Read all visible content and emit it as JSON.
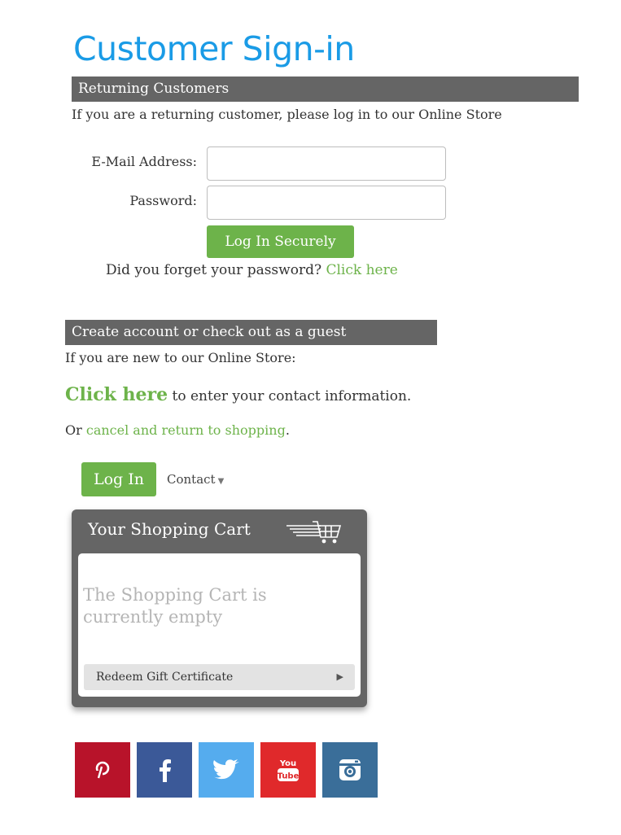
{
  "page": {
    "title": "Customer Sign-in"
  },
  "returning": {
    "header": "Returning Customers",
    "intro": "If you are a returning customer, please log in to our Online Store",
    "email_label": "E-Mail Address:",
    "email_value": "",
    "password_label": "Password:",
    "password_value": "",
    "login_button": "Log In Securely",
    "forgot_text": "Did you forget your password?",
    "forgot_link": "Click here"
  },
  "create": {
    "header": "Create account or check out as a guest",
    "intro": "If you are new to our Online Store:",
    "click_here": "Click here",
    "click_here_suffix": "to enter your contact information.",
    "or_text": "Or",
    "cancel_link": "cancel and return to shopping",
    "cancel_suffix": "."
  },
  "nav": {
    "login_button": "Log In",
    "contact_label": "Contact"
  },
  "cart": {
    "title": "Your Shopping Cart",
    "empty_message": "The Shopping Cart is currently empty",
    "redeem_label": "Redeem Gift Certificate"
  },
  "social": [
    {
      "name": "pinterest-icon",
      "color": "#b8132a"
    },
    {
      "name": "facebook-icon",
      "color": "#3b5998"
    },
    {
      "name": "twitter-icon",
      "color": "#55acee"
    },
    {
      "name": "youtube-icon",
      "color": "#e0292b",
      "text_top": "You",
      "text_bottom": "Tube"
    },
    {
      "name": "instagram-icon",
      "color": "#3a6e99"
    }
  ],
  "colors": {
    "title_blue": "#1a9be6",
    "accent_green": "#6db34a",
    "header_gray": "#656565"
  }
}
